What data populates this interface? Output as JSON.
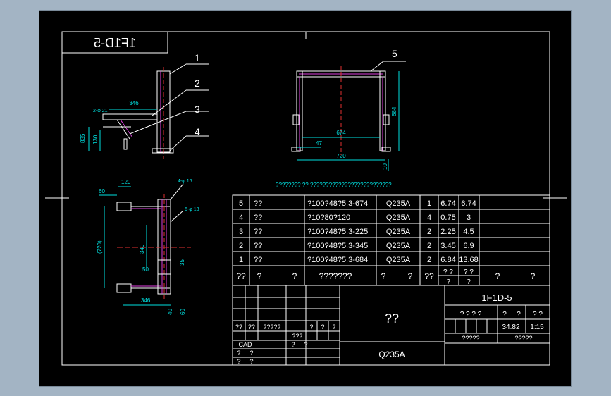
{
  "drawing": {
    "stamp_text": "1F1D-5",
    "part_callouts": [
      "1",
      "2",
      "3",
      "4"
    ],
    "callout_top_view": "5",
    "front_view_dims": {
      "width": "346",
      "height_total": "835",
      "sub_height": "130",
      "bolt_label": "2-φ 21"
    },
    "top_view_dims": {
      "width": "720",
      "inner": "674",
      "height": "684",
      "offset": "47",
      "base": "10"
    },
    "plan_view_dims": {
      "top": "120",
      "side": "60",
      "span": "(720)",
      "mid": "340",
      "small1": "50",
      "small2": "35",
      "bottom": "346",
      "b1": "40",
      "b2": "60",
      "hole1": "4-φ 16",
      "hole2": "6-φ 13"
    },
    "note_line": "????????  ??  ??????????????????????????"
  },
  "bom": {
    "rows": [
      {
        "no": "5",
        "name": "??",
        "spec": "?100?48?5.3-674",
        "material": "Q235A",
        "qty": "1",
        "unit": "6.74",
        "total": "6.74"
      },
      {
        "no": "4",
        "name": "??",
        "spec": "?10?80?120",
        "material": "Q235A",
        "qty": "4",
        "unit": "0.75",
        "total": "3"
      },
      {
        "no": "3",
        "name": "??",
        "spec": "?100?48?5.3-225",
        "material": "Q235A",
        "qty": "2",
        "unit": "2.25",
        "total": "4.5"
      },
      {
        "no": "2",
        "name": "??",
        "spec": "?100?48?5.3-345",
        "material": "Q235A",
        "qty": "2",
        "unit": "3.45",
        "total": "6.9"
      },
      {
        "no": "1",
        "name": "??",
        "spec": "?100?48?5.3-684",
        "material": "Q235A",
        "qty": "2",
        "unit": "6.84",
        "total": "13.68"
      }
    ],
    "header": {
      "c1": "??",
      "c2": "?",
      "c3": "?",
      "c4": "???????",
      "c5": "?",
      "c6": "?",
      "c7": "??",
      "c8a": "? ?",
      "c8b": "?",
      "c9a": "? ?",
      "c9b": "?",
      "c10": "?",
      "c11": "?"
    }
  },
  "title_block": {
    "drawing_no": "1F1D-5",
    "part_name": "??",
    "material": "Q235A",
    "weight": "34.82",
    "scale": "1:15",
    "cad_label": "CAD",
    "hdr_stage": "? ? ? ?",
    "hdr_weight": "?",
    "hdr_q": "?",
    "hdr_scale": "? ?",
    "sheet1": "?????",
    "sheet2": "?????",
    "left_row1": [
      "??",
      "??",
      "?????",
      "?",
      "?",
      "?"
    ],
    "left_row2": [
      "???"
    ],
    "left_rows": [
      [
        "?",
        "?"
      ],
      [
        "?",
        "?"
      ],
      [
        "?",
        "?"
      ]
    ]
  }
}
